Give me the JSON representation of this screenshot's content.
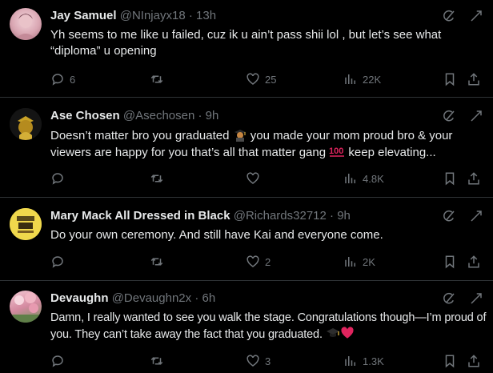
{
  "tweets": [
    {
      "name": "Jay Samuel",
      "handle": "@NInjayx18",
      "dot": "·",
      "time": "13h",
      "text": "Yh seems to me like u failed, cuz ik u ain’t pass shii lol , but let’s see what “diploma” u opening",
      "replies": "6",
      "reposts": "",
      "likes": "25",
      "views": "22K"
    },
    {
      "name": "Ase Chosen",
      "handle": "@Asechosen",
      "dot": "·",
      "time": "9h",
      "text_a": "Doesn’t matter bro you graduated ",
      "text_b": " you made your mom proud bro & your viewers are happy for you that’s all that matter gang ",
      "text_c": " keep elevating...",
      "replies": "",
      "reposts": "",
      "likes": "",
      "views": "4.8K"
    },
    {
      "name": "Mary Mack All Dressed in Black",
      "handle": "@Richards32712",
      "dot": "·",
      "time": "9h",
      "text": "Do your own ceremony. And still have Kai and everyone come.",
      "replies": "",
      "reposts": "",
      "likes": "2",
      "views": "2K"
    },
    {
      "name": "Devaughn",
      "handle": "@Devaughn2x",
      "dot": "·",
      "time": "6h",
      "text_a": "Damn, I really wanted to see you walk the stage. Congratulations though—I’m proud of you. They can’t take away the fact that you graduated. ",
      "replies": "",
      "reposts": "",
      "likes": "3",
      "views": "1.3K"
    }
  ],
  "icons": {
    "reply": "reply-icon",
    "repost": "repost-icon",
    "like": "like-icon",
    "views": "views-icon",
    "bookmark": "bookmark-icon",
    "share": "share-icon",
    "grok": "grok-icon",
    "more": "more-icon"
  },
  "colors": {
    "background": "#000000",
    "text": "#e7e9ea",
    "secondary": "#71767b",
    "divider": "#2f3336",
    "heart_emoji": "#e0245e",
    "hundred_emoji": "#e0245e"
  }
}
